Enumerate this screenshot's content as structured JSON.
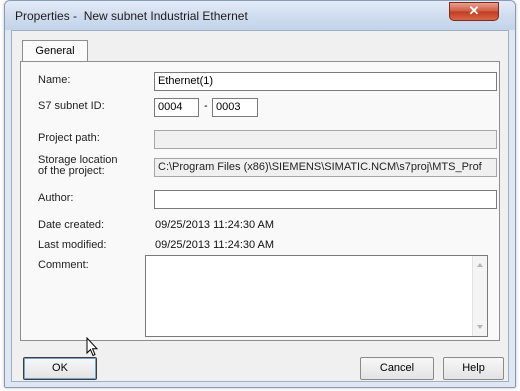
{
  "window": {
    "title": "Properties -  New subnet Industrial Ethernet",
    "close_glyph": "✕"
  },
  "tabs": [
    {
      "label": "General",
      "selected": true
    }
  ],
  "form": {
    "name_label": "Name:",
    "name_value": "Ethernet(1)",
    "subnet_id_label": "S7 subnet ID:",
    "subnet_id_part1": "0004",
    "subnet_id_separator": "-",
    "subnet_id_part2": "0003",
    "project_path_label": "Project path:",
    "project_path_value": "",
    "storage_label_line1": "Storage location",
    "storage_label_line2": "of the project:",
    "storage_value": "C:\\Program Files (x86)\\SIEMENS\\SIMATIC.NCM\\s7proj\\MTS_Prof",
    "author_label": "Author:",
    "author_value": "",
    "date_created_label": "Date created:",
    "date_created_value": "09/25/2013 11:24:30 AM",
    "last_modified_label": "Last modified:",
    "last_modified_value": "09/25/2013 11:24:30 AM",
    "comment_label": "Comment:",
    "comment_value": ""
  },
  "buttons": {
    "ok": "OK",
    "cancel": "Cancel",
    "help": "Help"
  },
  "icons": [
    "close-icon",
    "scroll-up-arrow-icon",
    "scroll-down-arrow-icon",
    "mouse-pointer-icon"
  ]
}
